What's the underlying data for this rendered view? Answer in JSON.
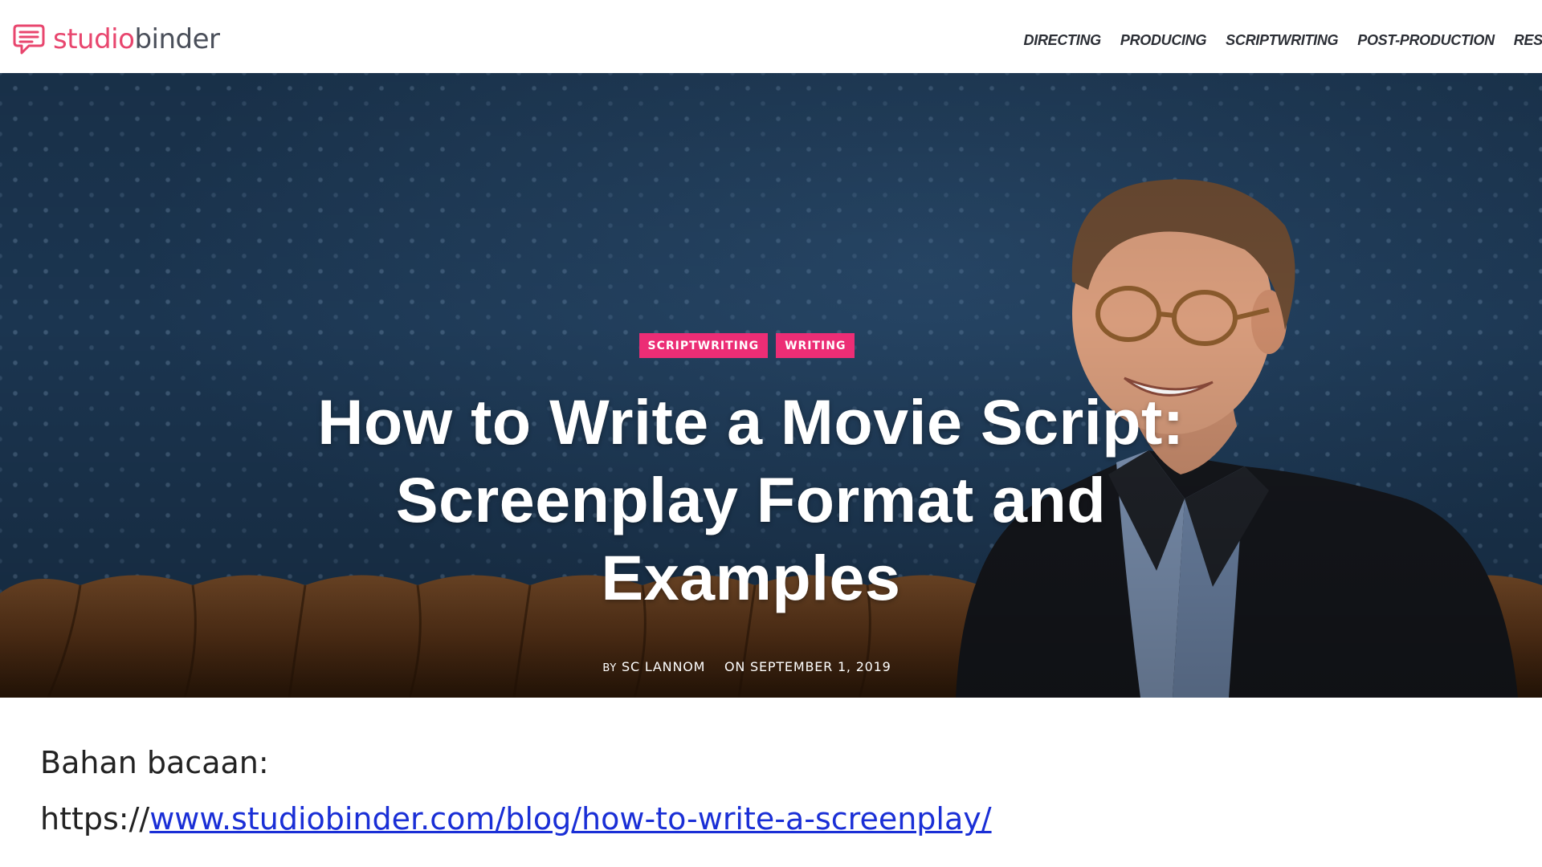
{
  "header": {
    "logo": {
      "part1": "studio",
      "part2": "binder"
    },
    "nav": [
      "DIRECTING",
      "PRODUCING",
      "SCRIPTWRITING",
      "POST-PRODUCTION",
      "RESOUR"
    ]
  },
  "hero": {
    "tags": [
      "SCRIPTWRITING",
      "WRITING"
    ],
    "title_lines": [
      "How to Write a Movie Script:",
      "Screenplay Format and",
      "Examples"
    ],
    "byline": {
      "by": "BY",
      "author": "SC LANNOM",
      "on": "ON SEPTEMBER 1, 2019"
    }
  },
  "reading": {
    "label": "Bahan bacaan:",
    "url_prefix": "https://",
    "url_link": "www.studiobinder.com/blog/how-to-write-a-screenplay/"
  },
  "colors": {
    "brand": "#e8466e",
    "tag": "#ec2d75",
    "link": "#1a2fd6",
    "hero_bg": "#1b3550"
  }
}
